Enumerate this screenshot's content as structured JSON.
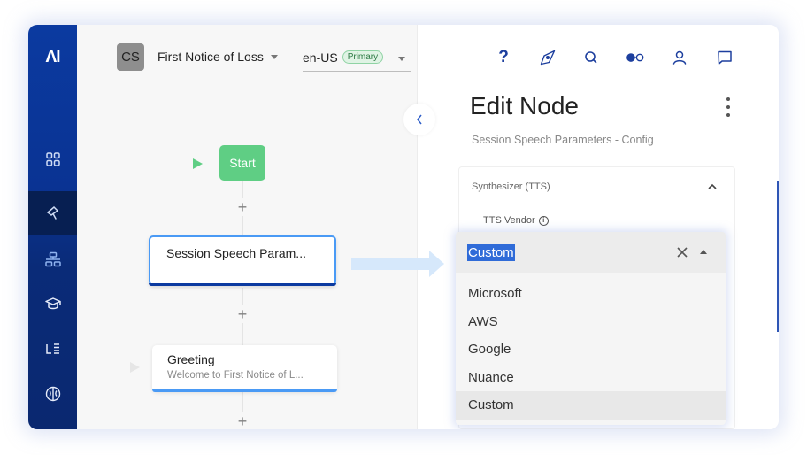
{
  "sidebar": {
    "logo": "ΛI",
    "items": [
      {
        "name": "dashboard",
        "icon": "grid-icon",
        "active": false
      },
      {
        "name": "design",
        "icon": "paint-roller-icon",
        "active": true
      },
      {
        "name": "flows",
        "icon": "hierarchy-icon",
        "active": false
      },
      {
        "name": "training",
        "icon": "graduation-cap-icon",
        "active": false
      },
      {
        "name": "language",
        "icon": "list-icon",
        "active": false
      },
      {
        "name": "ai-brain",
        "icon": "brain-icon",
        "active": false
      }
    ]
  },
  "header": {
    "avatar_initials": "CS",
    "flow_name": "First Notice of Loss",
    "language": "en-US",
    "language_badge": "Primary"
  },
  "canvas": {
    "start_label": "Start",
    "nodes": [
      {
        "title": "Session Speech Param...",
        "subtitle": "",
        "selected": true
      },
      {
        "title": "Greeting",
        "subtitle": "Welcome to First Notice of L...",
        "selected": false
      }
    ],
    "add_symbol": "+"
  },
  "toolbar": {
    "icons": [
      "help-icon",
      "compass-icon",
      "search-icon",
      "toggle-icon",
      "user-icon",
      "chat-icon"
    ],
    "help_label": "?"
  },
  "panel": {
    "title": "Edit Node",
    "subtitle": "Session Speech Parameters - Config",
    "section": {
      "title": "Synthesizer (TTS)",
      "expanded": true,
      "field_label": "TTS Vendor",
      "info_symbol": "i"
    }
  },
  "dropdown": {
    "value": "Custom",
    "options": [
      "Microsoft",
      "AWS",
      "Google",
      "Nuance",
      "Custom"
    ],
    "selected_index": 4,
    "highlight_color": "#2f6bd8"
  },
  "colors": {
    "sidebar": "#0b3aa0",
    "accent": "#1d3f9e",
    "start_node": "#5fce84",
    "node_border": "#4a9af5"
  }
}
